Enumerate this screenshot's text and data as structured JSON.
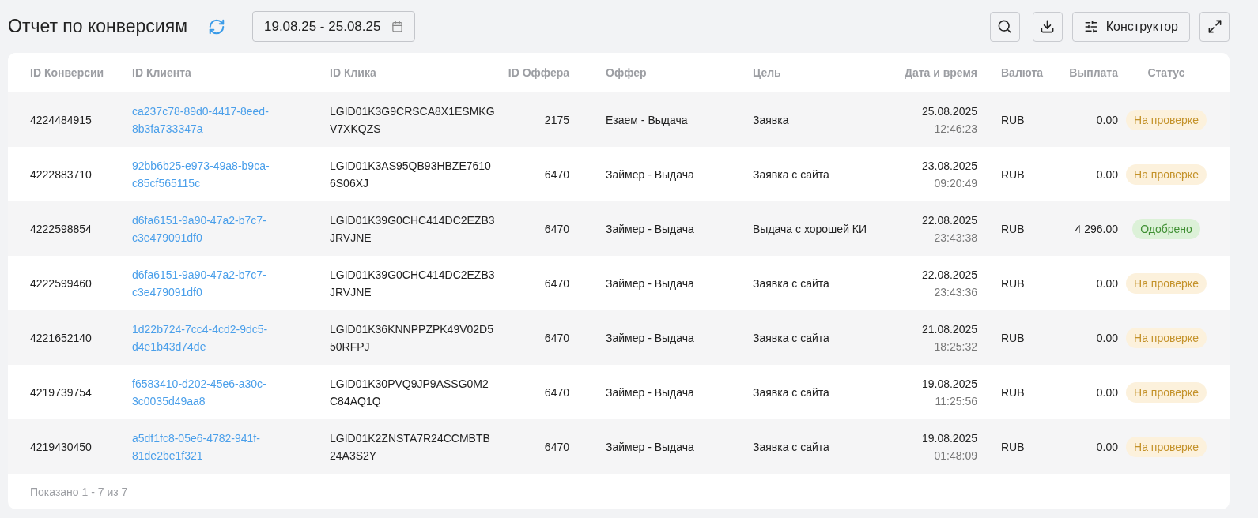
{
  "header": {
    "title": "Отчет по конверсиям",
    "date_range": "19.08.25 - 25.08.25",
    "constructor_button": "Конструктор"
  },
  "table": {
    "columns": [
      "ID Конверсии",
      "ID Клиента",
      "ID Клика",
      "ID Оффера",
      "Оффер",
      "Цель",
      "Дата и время",
      "Валюта",
      "Выплата",
      "Статус"
    ],
    "rows": [
      {
        "conversion_id": "4224484915",
        "client_id": "ca237c78-89d0-4417-8eed-8b3fa733347a",
        "click_id": "LGID01K3G9CRSCA8X1ESMKGV7XKQZS",
        "offer_id": "2175",
        "offer": "Езаем - Выдача",
        "goal": "Заявка",
        "date": "25.08.2025",
        "time": "12:46:23",
        "currency": "RUB",
        "payout": "0.00",
        "status": {
          "text": "На проверке",
          "kind": "pending"
        }
      },
      {
        "conversion_id": "4222883710",
        "client_id": "92bb6b25-e973-49a8-b9ca-c85cf565115c",
        "click_id": "LGID01K3AS95QB93HBZE76106S06XJ",
        "offer_id": "6470",
        "offer": "Займер - Выдача",
        "goal": "Заявка с сайта",
        "date": "23.08.2025",
        "time": "09:20:49",
        "currency": "RUB",
        "payout": "0.00",
        "status": {
          "text": "На проверке",
          "kind": "pending"
        }
      },
      {
        "conversion_id": "4222598854",
        "client_id": "d6fa6151-9a90-47a2-b7c7-c3e479091df0",
        "click_id": "LGID01K39G0CHC414DC2EZB3JRVJNE",
        "offer_id": "6470",
        "offer": "Займер - Выдача",
        "goal": "Выдача с хорошей КИ",
        "date": "22.08.2025",
        "time": "23:43:38",
        "currency": "RUB",
        "payout": "4 296.00",
        "status": {
          "text": "Одобрено",
          "kind": "approved"
        }
      },
      {
        "conversion_id": "4222599460",
        "client_id": "d6fa6151-9a90-47a2-b7c7-c3e479091df0",
        "click_id": "LGID01K39G0CHC414DC2EZB3JRVJNE",
        "offer_id": "6470",
        "offer": "Займер - Выдача",
        "goal": "Заявка с сайта",
        "date": "22.08.2025",
        "time": "23:43:36",
        "currency": "RUB",
        "payout": "0.00",
        "status": {
          "text": "На проверке",
          "kind": "pending"
        }
      },
      {
        "conversion_id": "4221652140",
        "client_id": "1d22b724-7cc4-4cd2-9dc5-d4e1b43d74de",
        "click_id": "LGID01K36KNNPPZPK49V02D550RFPJ",
        "offer_id": "6470",
        "offer": "Займер - Выдача",
        "goal": "Заявка с сайта",
        "date": "21.08.2025",
        "time": "18:25:32",
        "currency": "RUB",
        "payout": "0.00",
        "status": {
          "text": "На проверке",
          "kind": "pending"
        }
      },
      {
        "conversion_id": "4219739754",
        "client_id": "f6583410-d202-45e6-a30c-3c0035d49aa8",
        "click_id": "LGID01K30PVQ9JP9ASSG0M2C84AQ1Q",
        "offer_id": "6470",
        "offer": "Займер - Выдача",
        "goal": "Заявка с сайта",
        "date": "19.08.2025",
        "time": "11:25:56",
        "currency": "RUB",
        "payout": "0.00",
        "status": {
          "text": "На проверке",
          "kind": "pending"
        }
      },
      {
        "conversion_id": "4219430450",
        "client_id": "a5df1fc8-05e6-4782-941f-81de2be1f321",
        "click_id": "LGID01K2ZNSTA7R24CCMBTB24A3S2Y",
        "offer_id": "6470",
        "offer": "Займер - Выдача",
        "goal": "Заявка с сайта",
        "date": "19.08.2025",
        "time": "01:48:09",
        "currency": "RUB",
        "payout": "0.00",
        "status": {
          "text": "На проверке",
          "kind": "pending"
        }
      }
    ],
    "footer": "Показано 1 - 7 из 7"
  }
}
